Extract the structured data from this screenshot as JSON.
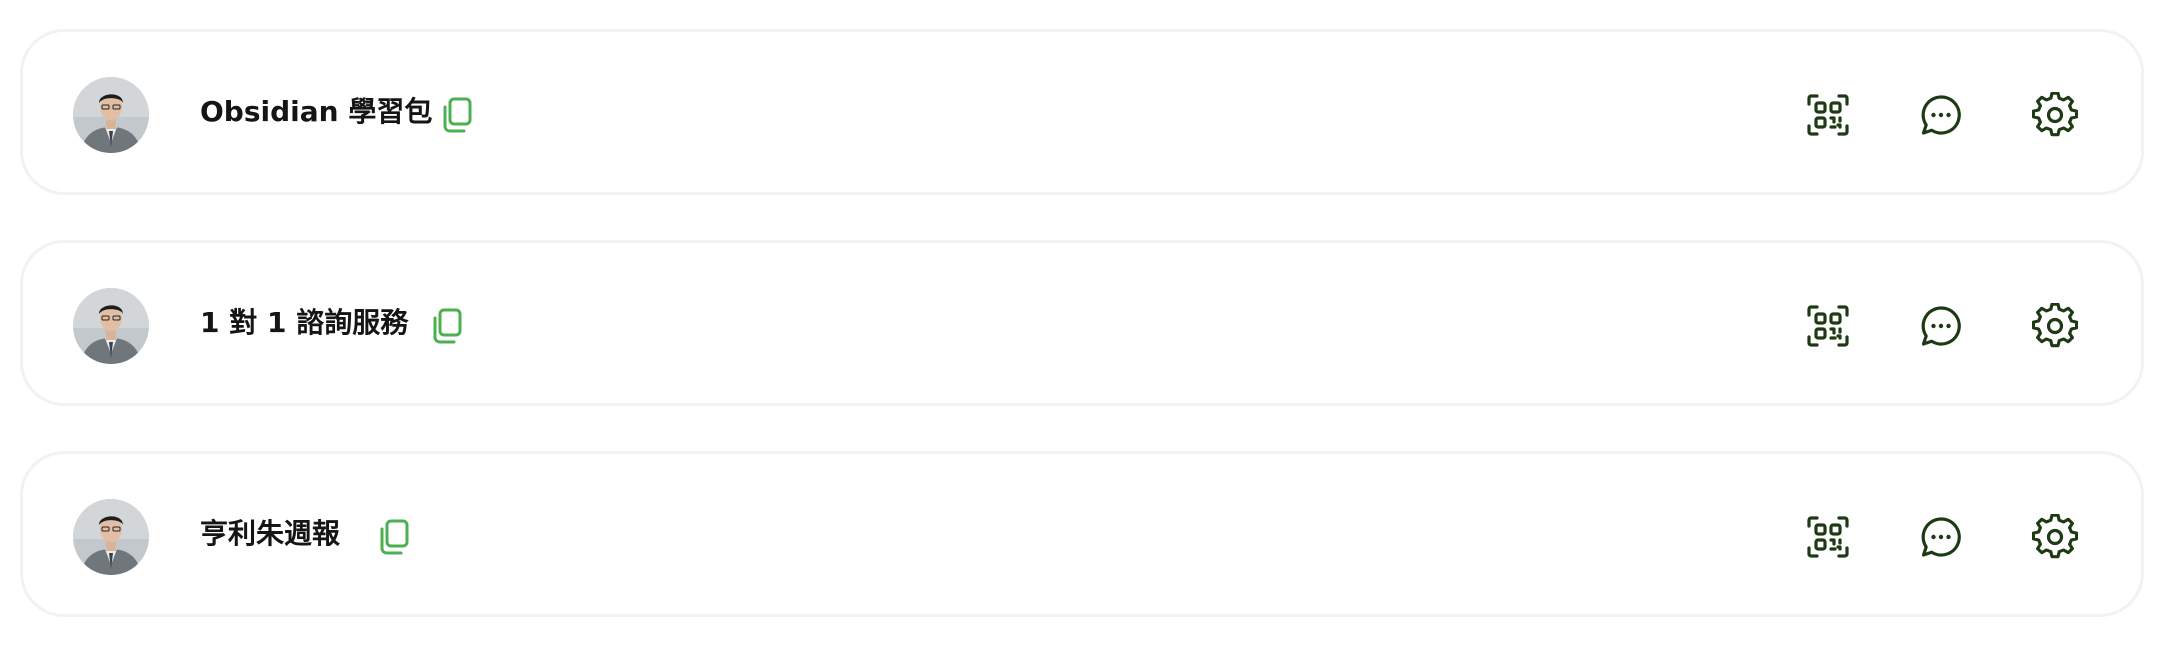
{
  "colors": {
    "copy_icon": "#4caf50",
    "action_icon": "#1e3a14",
    "card_border": "#f1f2f1",
    "title_text": "#151515"
  },
  "items": [
    {
      "title": "Obsidian 學習包",
      "avatar_icon": "profile-photo",
      "copy_icon": "copy-icon",
      "actions": [
        "qr-code-icon",
        "chat-icon",
        "gear-icon"
      ]
    },
    {
      "title": "1 對 1 諮詢服務",
      "avatar_icon": "profile-photo",
      "copy_icon": "copy-icon",
      "actions": [
        "qr-code-icon",
        "chat-icon",
        "gear-icon"
      ]
    },
    {
      "title": "亨利朱週報",
      "avatar_icon": "profile-photo",
      "copy_icon": "copy-icon",
      "actions": [
        "qr-code-icon",
        "chat-icon",
        "gear-icon"
      ]
    }
  ]
}
